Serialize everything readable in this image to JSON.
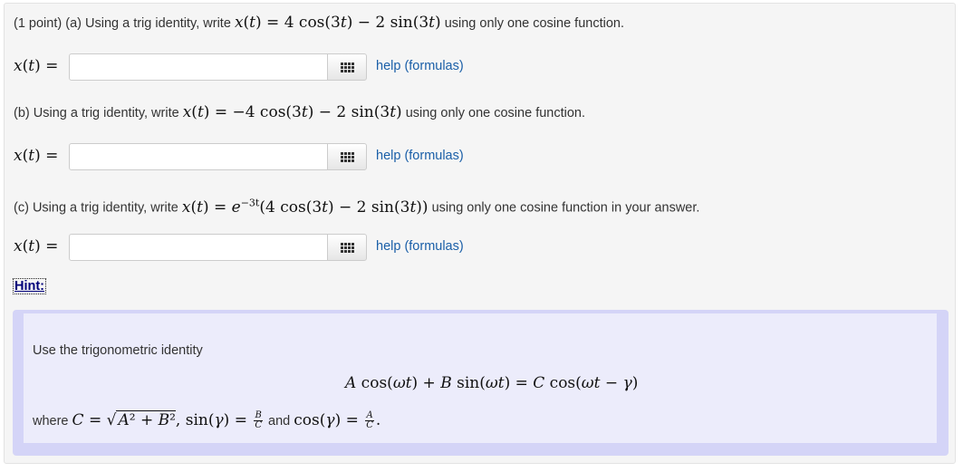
{
  "problem": {
    "points": "(1 point)",
    "parts": [
      {
        "label": "(a)",
        "prefix": "Using a trig identity, write",
        "expr_a": "4 cos(3",
        "expr_b": ") − 2 sin(3",
        "expr_c": ")",
        "suffix": "using only one cosine function.",
        "answer_value": "",
        "help_label": "help (formulas)"
      },
      {
        "label": "(b)",
        "prefix": "Using a trig identity, write",
        "expr_a": "−4 cos(3",
        "expr_b": ") − 2 sin(3",
        "expr_c": ")",
        "suffix": "using only one cosine function.",
        "answer_value": "",
        "help_label": "help (formulas)"
      },
      {
        "label": "(c)",
        "prefix": "Using a trig identity, write",
        "exp": "−3t",
        "expr_a": "(4 cos(3",
        "expr_b": ") − 2 sin(3",
        "expr_c": "))",
        "suffix": "using only one cosine function in your answer.",
        "answer_value": "",
        "help_label": "help (formulas)"
      }
    ],
    "answer_label": "x(t) ="
  },
  "hint": {
    "link_label": "Hint:",
    "intro": "Use the trigonometric identity",
    "identity": "A cos(ωt) + B sin(ωt) = C cos(ωt − γ)",
    "where": "where",
    "and": "and",
    "sqrt_body": "A² + B²",
    "frac_b": {
      "num": "B",
      "den": "C"
    },
    "frac_a": {
      "num": "A",
      "den": "C"
    }
  },
  "icons": {
    "palette": "grid-icon"
  },
  "colors": {
    "link": "#1a5fa8",
    "hint_link": "#00007a",
    "hint_background": "#ececfb",
    "hint_border": "#d4d4f7"
  }
}
